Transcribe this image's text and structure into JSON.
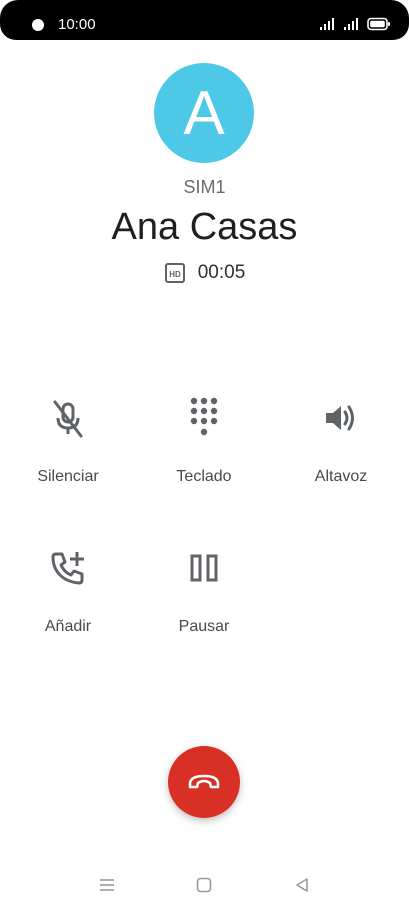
{
  "status_bar": {
    "time": "10:00",
    "icons": [
      "wifi-icon",
      "signal-icon",
      "battery-icon"
    ]
  },
  "contact": {
    "initial": "A",
    "sim": "SIM1",
    "name": "Ana Casas",
    "avatar_color": "#4dc8e6"
  },
  "call": {
    "hd_badge": "HD",
    "duration": "00:05"
  },
  "actions": {
    "mute": "Silenciar",
    "keypad": "Teclado",
    "speaker": "Altavoz",
    "add": "Añadir",
    "hold": "Pausar"
  },
  "end_call": {
    "color": "#d93025"
  },
  "nav_bar": {
    "icons": [
      "recents-icon",
      "home-icon",
      "back-icon"
    ]
  }
}
